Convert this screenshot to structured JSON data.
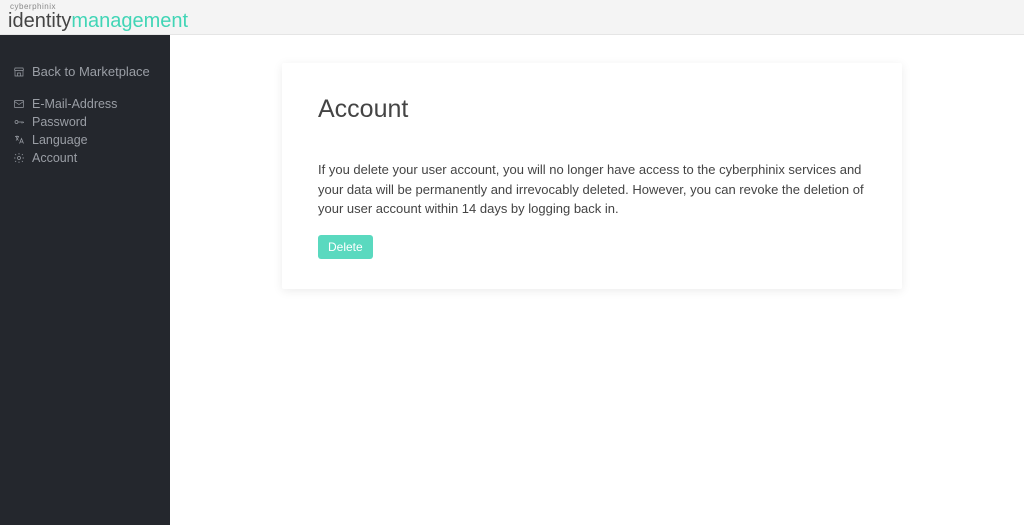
{
  "brand": {
    "small": "cyberphinix",
    "main1": "identity",
    "main2": "management"
  },
  "sidebar": {
    "marketplace_label": "Back to Marketplace",
    "email_label": "E-Mail-Address",
    "password_label": "Password",
    "language_label": "Language",
    "account_label": "Account"
  },
  "card": {
    "title": "Account",
    "body": "If you delete your user account, you will no longer have access to the cyberphinix services and your data will be permanently and irrevocably deleted. However, you can revoke the deletion of your user account within 14 days by logging back in.",
    "delete_label": "Delete"
  }
}
